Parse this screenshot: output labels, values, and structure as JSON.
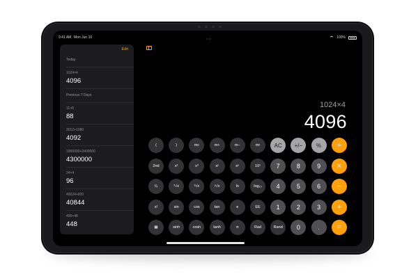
{
  "status": {
    "time": "9:41 AM",
    "date": "Mon Jun 10",
    "battery": "100%"
  },
  "history": {
    "edit_label": "Edit",
    "sections": [
      "Today",
      "Previous 7 Days"
    ],
    "items": [
      {
        "expr": "1024×4",
        "result": "4096"
      },
      {
        "expr": "11×8",
        "result": "88"
      },
      {
        "expr": "3012+1080",
        "result": "4092"
      },
      {
        "expr": "1900000+2400000",
        "result": "4300000"
      },
      {
        "expr": "24×4",
        "result": "96"
      },
      {
        "expr": "40024+820",
        "result": "40844"
      },
      {
        "expr": "400+48",
        "result": "448"
      }
    ]
  },
  "display": {
    "expression": "1024×4",
    "value": "4096"
  },
  "keypad": {
    "rows": [
      [
        "(",
        ")",
        "mc",
        "m+",
        "m−",
        "mr",
        "AC",
        "+/−",
        "%",
        "÷"
      ],
      [
        "2nd",
        "x²",
        "x³",
        "xʸ",
        "eˣ",
        "10ˣ",
        "7",
        "8",
        "9",
        "×"
      ],
      [
        "¹⁄ₓ",
        "²√x",
        "³√x",
        "ʸ√x",
        "ln",
        "log₁₀",
        "4",
        "5",
        "6",
        "−"
      ],
      [
        "x!",
        "sin",
        "cos",
        "tan",
        "e",
        "EE",
        "1",
        "2",
        "3",
        "+"
      ],
      [
        "▦",
        "sinh",
        "cosh",
        "tanh",
        "π",
        "Rad",
        "Rand",
        "0",
        ".",
        "="
      ]
    ]
  },
  "colors": {
    "accent": "#ff9f0a",
    "number_key": "#505053",
    "function_key": "#333335",
    "light_key": "#a5a5a7"
  }
}
